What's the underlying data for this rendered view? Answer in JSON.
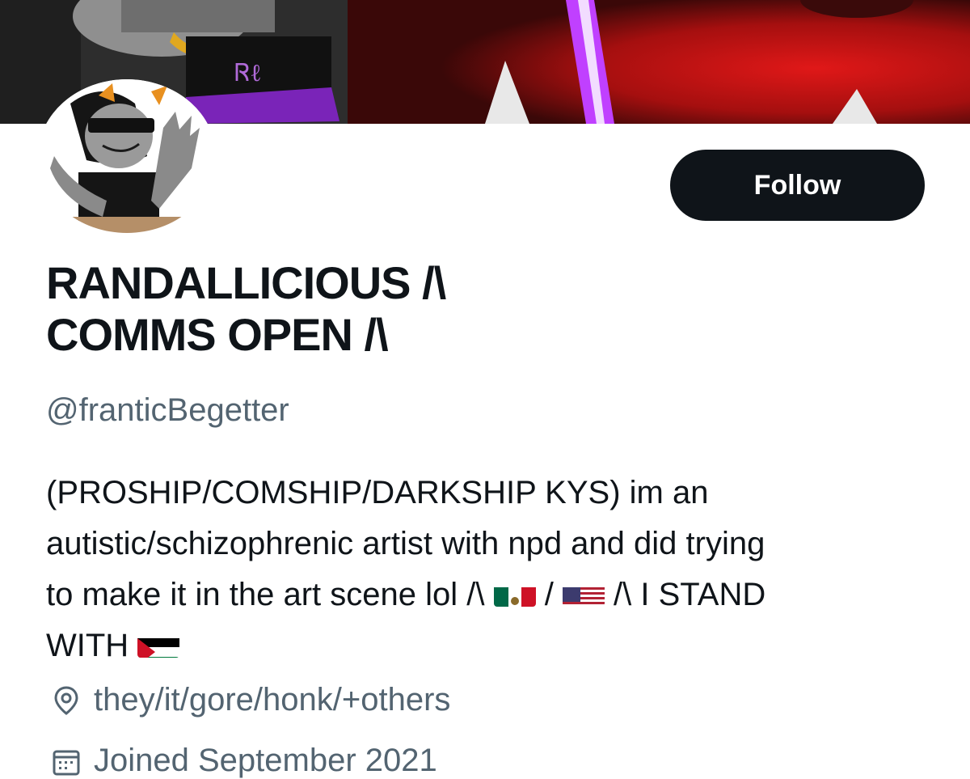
{
  "profile": {
    "follow_label": "Follow",
    "display_name_line1": "RANDALLICIOUS /\\",
    "display_name_line2": "COMMS OPEN /\\",
    "handle": "@franticBegetter",
    "bio": {
      "line1": "(PROSHIP/COMSHIP/DARKSHIP KYS) im an",
      "line2": "autistic/schizophrenic artist with npd and did trying",
      "line3_a": "to make it in the art scene lol /\\ ",
      "line3_b": " / ",
      "line3_c": " /\\ I STAND",
      "line4": "WITH "
    },
    "location": "they/it/gore/honk/+others",
    "joined": "Joined September 2021"
  },
  "icons": {
    "location": "location-pin-icon",
    "calendar": "calendar-icon"
  },
  "colors": {
    "follow_bg": "#0f1419",
    "secondary_text": "#536471",
    "primary_text": "#0f1419"
  }
}
